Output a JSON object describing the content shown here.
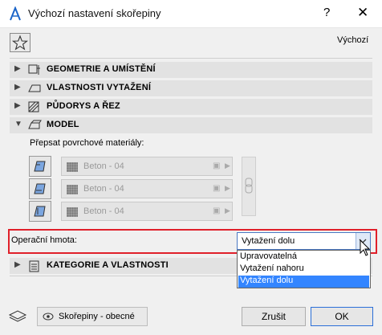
{
  "window": {
    "title": "Výchozí nastavení skořepiny",
    "help": "?",
    "close": "✕"
  },
  "toolbar": {
    "default_label": "Výchozí"
  },
  "sections": [
    {
      "label": "GEOMETRIE A UMÍSTĚNÍ",
      "expanded": false
    },
    {
      "label": "VLASTNOSTI VYTAŽENÍ",
      "expanded": false
    },
    {
      "label": "PŮDORYS A ŘEZ",
      "expanded": false
    },
    {
      "label": "MODEL",
      "expanded": true
    }
  ],
  "model": {
    "override_label": "Přepsat povrchové materiály:",
    "materials": [
      "Beton - 04",
      "Beton - 04",
      "Beton - 04"
    ],
    "operation_label": "Operační hmota:",
    "operation_value": "Vytažení dolu",
    "operation_options": [
      "Upravovatelná",
      "Vytažení nahoru",
      "Vytažení dolu"
    ],
    "selected_option_index": 2
  },
  "category_section": {
    "label": "KATEGORIE A VLASTNOSTI"
  },
  "footer": {
    "favorite": "Skořepiny - obecné",
    "cancel": "Zrušit",
    "ok": "OK"
  },
  "colors": {
    "highlight": "#e0202a",
    "selection": "#3385ff",
    "combo_border": "#4a78c2"
  }
}
